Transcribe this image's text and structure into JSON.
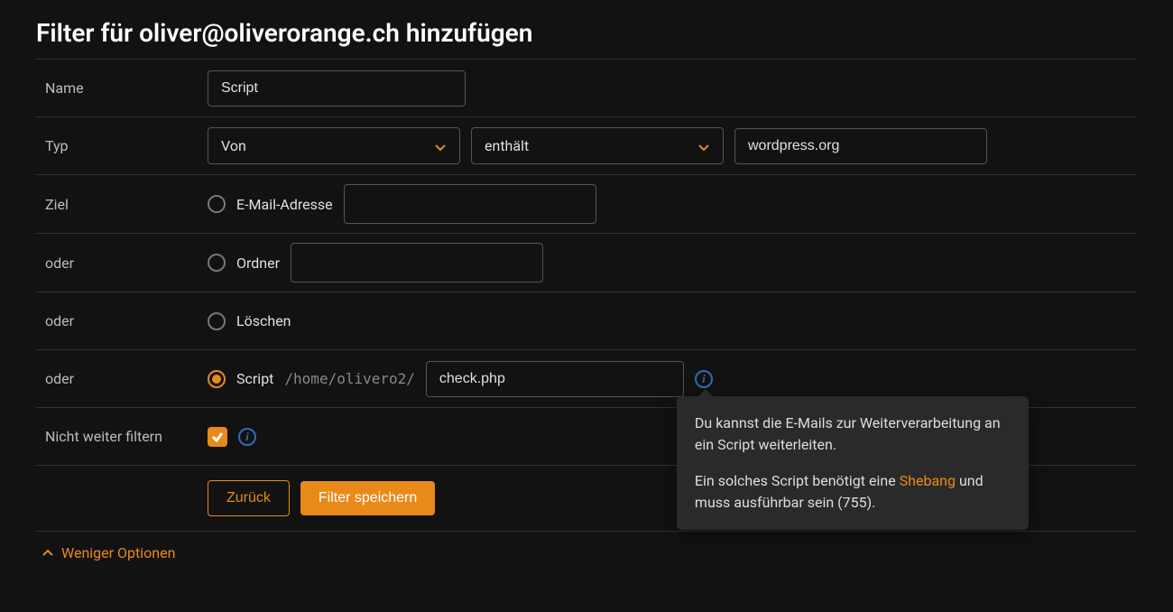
{
  "title": "Filter für oliver@oliverorange.ch hinzufügen",
  "labels": {
    "name": "Name",
    "type": "Typ",
    "target": "Ziel",
    "or1": "oder",
    "or2": "oder",
    "or3": "oder",
    "no_further": "Nicht weiter filtern"
  },
  "name_value": "Script",
  "type_from": "Von",
  "type_match": "enthält",
  "type_value": "wordpress.org",
  "target_email_label": "E-Mail-Adresse",
  "target_email_value": "",
  "target_folder_label": "Ordner",
  "target_folder_value": "",
  "target_delete_label": "Löschen",
  "target_script_label": "Script",
  "target_script_path": "/home/olivero2/",
  "target_script_value": "check.php",
  "no_further_checked": true,
  "buttons": {
    "back": "Zurück",
    "save": "Filter speichern"
  },
  "less_options": "Weniger Optionen",
  "tooltip": {
    "p1": "Du kannst die E-Mails zur Weiterverarbeitung an ein Script weiterleiten.",
    "p2_a": "Ein solches Script benötigt eine ",
    "p2_link": "Shebang",
    "p2_b": " und muss ausführbar sein (755)."
  },
  "colors": {
    "accent": "#e88a1a",
    "info": "#2f6db3"
  }
}
